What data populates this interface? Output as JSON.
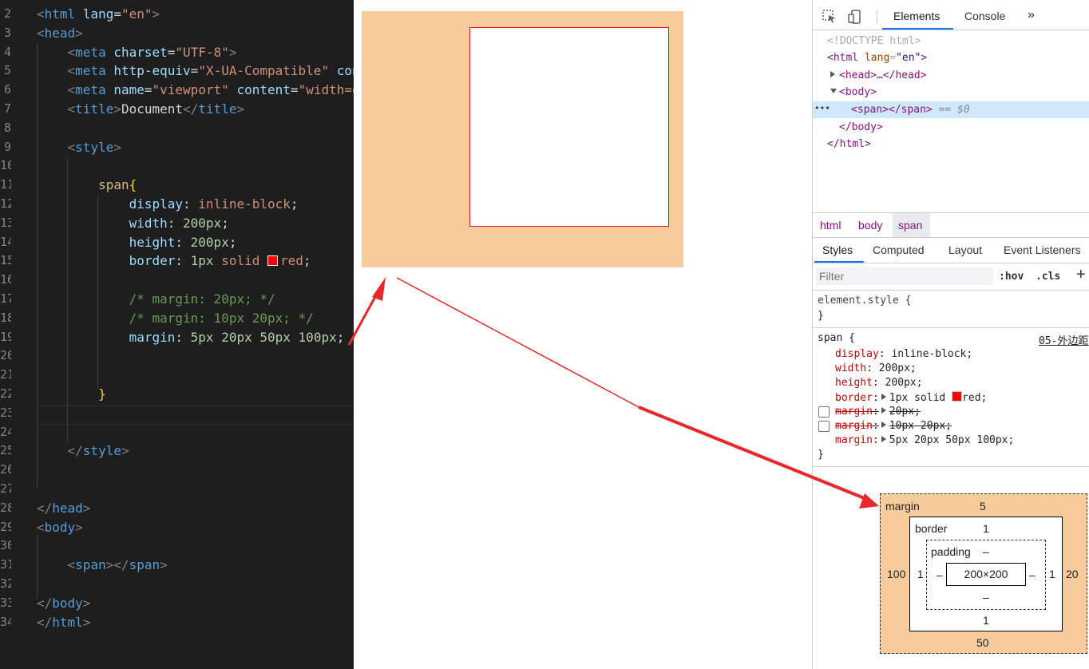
{
  "editor": {
    "line_numbers": [
      "2",
      "3",
      "4",
      "5",
      "6",
      "7",
      "8",
      "9",
      "10",
      "11",
      "12",
      "13",
      "14",
      "15",
      "16",
      "17",
      "18",
      "19",
      "20",
      "21",
      "22",
      "23",
      "24",
      "25",
      "26",
      "27",
      "28",
      "29",
      "30",
      "31",
      "32",
      "33",
      "34"
    ],
    "lines": [
      [
        {
          "c": "t-punc",
          "t": "<"
        },
        {
          "c": "t-tag",
          "t": "html"
        },
        {
          "c": "t-text",
          "t": " "
        },
        {
          "c": "t-attr",
          "t": "lang"
        },
        {
          "c": "t-text",
          "t": "="
        },
        {
          "c": "t-str",
          "t": "\"en\""
        },
        {
          "c": "t-punc",
          "t": ">"
        }
      ],
      [
        {
          "c": "t-punc",
          "t": "<"
        },
        {
          "c": "t-tag",
          "t": "head"
        },
        {
          "c": "t-punc",
          "t": ">"
        }
      ],
      [
        {
          "c": "t-text",
          "t": "    "
        },
        {
          "c": "t-punc",
          "t": "<"
        },
        {
          "c": "t-tag",
          "t": "meta"
        },
        {
          "c": "t-text",
          "t": " "
        },
        {
          "c": "t-attr",
          "t": "charset"
        },
        {
          "c": "t-text",
          "t": "="
        },
        {
          "c": "t-str",
          "t": "\"UTF-8\""
        },
        {
          "c": "t-punc",
          "t": ">"
        }
      ],
      [
        {
          "c": "t-text",
          "t": "    "
        },
        {
          "c": "t-punc",
          "t": "<"
        },
        {
          "c": "t-tag",
          "t": "meta"
        },
        {
          "c": "t-text",
          "t": " "
        },
        {
          "c": "t-attr",
          "t": "http-equiv"
        },
        {
          "c": "t-text",
          "t": "="
        },
        {
          "c": "t-str",
          "t": "\"X-UA-Compatible\""
        },
        {
          "c": "t-text",
          "t": " "
        },
        {
          "c": "t-attr",
          "t": "con"
        }
      ],
      [
        {
          "c": "t-text",
          "t": "    "
        },
        {
          "c": "t-punc",
          "t": "<"
        },
        {
          "c": "t-tag",
          "t": "meta"
        },
        {
          "c": "t-text",
          "t": " "
        },
        {
          "c": "t-attr",
          "t": "name"
        },
        {
          "c": "t-text",
          "t": "="
        },
        {
          "c": "t-str",
          "t": "\"viewport\""
        },
        {
          "c": "t-text",
          "t": " "
        },
        {
          "c": "t-attr",
          "t": "content"
        },
        {
          "c": "t-text",
          "t": "="
        },
        {
          "c": "t-str",
          "t": "\"width=d"
        }
      ],
      [
        {
          "c": "t-text",
          "t": "    "
        },
        {
          "c": "t-punc",
          "t": "<"
        },
        {
          "c": "t-tag",
          "t": "title"
        },
        {
          "c": "t-punc",
          "t": ">"
        },
        {
          "c": "t-text",
          "t": "Document"
        },
        {
          "c": "t-punc",
          "t": "</"
        },
        {
          "c": "t-tag",
          "t": "title"
        },
        {
          "c": "t-punc",
          "t": ">"
        }
      ],
      [],
      [
        {
          "c": "t-text",
          "t": "    "
        },
        {
          "c": "t-punc",
          "t": "<"
        },
        {
          "c": "t-tag",
          "t": "style"
        },
        {
          "c": "t-punc",
          "t": ">"
        }
      ],
      [],
      [
        {
          "c": "t-text",
          "t": "        "
        },
        {
          "c": "t-sel",
          "t": "span"
        },
        {
          "c": "t-brace",
          "t": "{"
        }
      ],
      [
        {
          "c": "t-text",
          "t": "            "
        },
        {
          "c": "t-prop",
          "t": "display"
        },
        {
          "c": "t-text",
          "t": ": "
        },
        {
          "c": "t-val",
          "t": "inline-block"
        },
        {
          "c": "t-text",
          "t": ";"
        }
      ],
      [
        {
          "c": "t-text",
          "t": "            "
        },
        {
          "c": "t-prop",
          "t": "width"
        },
        {
          "c": "t-text",
          "t": ": "
        },
        {
          "c": "t-num",
          "t": "200px"
        },
        {
          "c": "t-text",
          "t": ";"
        }
      ],
      [
        {
          "c": "t-text",
          "t": "            "
        },
        {
          "c": "t-prop",
          "t": "height"
        },
        {
          "c": "t-text",
          "t": ": "
        },
        {
          "c": "t-num",
          "t": "200px"
        },
        {
          "c": "t-text",
          "t": ";"
        }
      ],
      [
        {
          "c": "t-text",
          "t": "            "
        },
        {
          "c": "t-prop",
          "t": "border"
        },
        {
          "c": "t-text",
          "t": ": "
        },
        {
          "c": "t-num",
          "t": "1px"
        },
        {
          "c": "t-text",
          "t": " "
        },
        {
          "c": "t-val",
          "t": "solid"
        },
        {
          "c": "t-text",
          "t": " "
        },
        {
          "c": "swatch",
          "t": ""
        },
        {
          "c": "t-val",
          "t": "red"
        },
        {
          "c": "t-text",
          "t": ";"
        }
      ],
      [],
      [
        {
          "c": "t-text",
          "t": "            "
        },
        {
          "c": "t-com",
          "t": "/* margin: 20px; */"
        }
      ],
      [
        {
          "c": "t-text",
          "t": "            "
        },
        {
          "c": "t-com",
          "t": "/* margin: 10px 20px; */"
        }
      ],
      [
        {
          "c": "t-text",
          "t": "            "
        },
        {
          "c": "t-prop",
          "t": "margin"
        },
        {
          "c": "t-text",
          "t": ": "
        },
        {
          "c": "t-num",
          "t": "5px"
        },
        {
          "c": "t-text",
          "t": " "
        },
        {
          "c": "t-num",
          "t": "20px"
        },
        {
          "c": "t-text",
          "t": " "
        },
        {
          "c": "t-num",
          "t": "50px"
        },
        {
          "c": "t-text",
          "t": " "
        },
        {
          "c": "t-num",
          "t": "100px"
        },
        {
          "c": "t-text",
          "t": ";"
        }
      ],
      [],
      [],
      [
        {
          "c": "t-text",
          "t": "        "
        },
        {
          "c": "t-brace",
          "t": "}"
        }
      ],
      [],
      [],
      [
        {
          "c": "t-text",
          "t": "    "
        },
        {
          "c": "t-punc",
          "t": "</"
        },
        {
          "c": "t-tag",
          "t": "style"
        },
        {
          "c": "t-punc",
          "t": ">"
        }
      ],
      [],
      [],
      [
        {
          "c": "t-punc",
          "t": "</"
        },
        {
          "c": "t-tag",
          "t": "head"
        },
        {
          "c": "t-punc",
          "t": ">"
        }
      ],
      [
        {
          "c": "t-punc",
          "t": "<"
        },
        {
          "c": "t-tag",
          "t": "body"
        },
        {
          "c": "t-punc",
          "t": ">"
        }
      ],
      [],
      [
        {
          "c": "t-text",
          "t": "    "
        },
        {
          "c": "t-punc",
          "t": "<"
        },
        {
          "c": "t-tag",
          "t": "span"
        },
        {
          "c": "t-punc",
          "t": "></"
        },
        {
          "c": "t-tag",
          "t": "span"
        },
        {
          "c": "t-punc",
          "t": ">"
        }
      ],
      [],
      [
        {
          "c": "t-punc",
          "t": "</"
        },
        {
          "c": "t-tag",
          "t": "body"
        },
        {
          "c": "t-punc",
          "t": ">"
        }
      ],
      [
        {
          "c": "t-punc",
          "t": "</"
        },
        {
          "c": "t-tag",
          "t": "html"
        },
        {
          "c": "t-punc",
          "t": ">"
        }
      ]
    ]
  },
  "preview": {
    "margin_color": "#f7cc9d",
    "border_color": "#e31b1b"
  },
  "annotation": {
    "arrow_color": "#e8282b"
  },
  "devtools": {
    "tabs": {
      "elements": "Elements",
      "console": "Console",
      "more": "»"
    },
    "icons": {
      "inspect": "inspect-icon",
      "device": "device-toolbar-icon"
    },
    "dom": {
      "doctype": "<!DOCTYPE html>",
      "html_open": "<html",
      "html_attr": "lang",
      "html_attr_value": "\"en\"",
      "html_open_end": ">",
      "head_collapsed": "<head>…</head>",
      "body_open": "<body>",
      "selected_span": "<span></span>",
      "selected_suffix": "== $0",
      "selected_dots": "•••",
      "body_close": "</body>",
      "html_close": "</html>"
    },
    "breadcrumbs": [
      "html",
      "body",
      "span"
    ],
    "sub_tabs": [
      "Styles",
      "Computed",
      "Layout",
      "Event Listeners"
    ],
    "filter_placeholder": "Filter",
    "hov": ":hov",
    "cls": ".cls",
    "add": "+",
    "element_style": "element.style {",
    "close_brace": "}",
    "rule_selector": "span {",
    "rule_source": "05-外边距",
    "declarations": {
      "display_prop": "display",
      "display_val": "inline-block;",
      "width_prop": "width",
      "width_val": "200px;",
      "height_prop": "height",
      "height_val": "200px;",
      "border_prop": "border",
      "border_val": "1px solid",
      "border_color": "red;",
      "m1_prop": "margin",
      "m1_val": "20px;",
      "m2_prop": "margin",
      "m2_val": "10px 20px;",
      "m3_prop": "margin",
      "m3_val": "5px 20px 50px 100px;"
    },
    "box_model": {
      "margin_label": "margin",
      "margin_top": "5",
      "margin_right": "20",
      "margin_bottom": "50",
      "margin_left": "100",
      "border_label": "border",
      "border_top": "1",
      "border_right": "1",
      "border_bottom": "1",
      "border_left": "1",
      "padding_label": "padding",
      "padding_top": "–",
      "padding_right": "–",
      "padding_bottom": "–",
      "padding_left": "–",
      "content": "200×200"
    }
  }
}
